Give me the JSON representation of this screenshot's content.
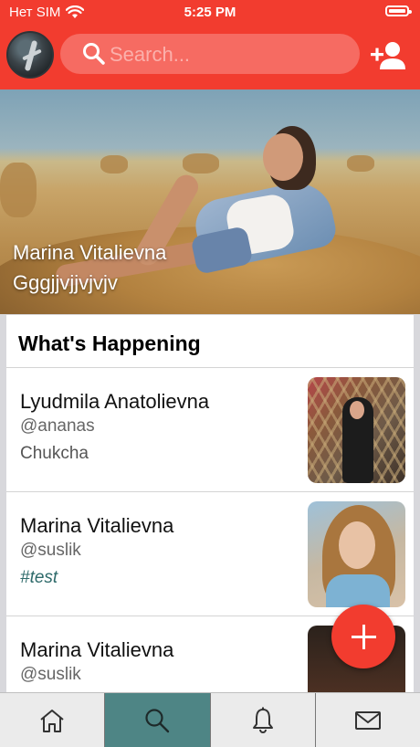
{
  "status_bar": {
    "carrier": "Нет SIM",
    "time": "5:25 PM"
  },
  "header": {
    "search_placeholder": "Search...",
    "brand_color": "#f23c2f",
    "icons": [
      "avatar",
      "search-icon",
      "add-user-icon"
    ]
  },
  "profile": {
    "name": "Marina Vitalievna",
    "bio": "Gggjjvjjvjvjv"
  },
  "feed": {
    "title": "What's Happening",
    "items": [
      {
        "name": "Lyudmila Anatolievna",
        "handle": "@ananas",
        "text": "Chukcha"
      },
      {
        "name": "Marina Vitalievna",
        "handle": "@suslik",
        "text": "#test"
      },
      {
        "name": "Marina Vitalievna",
        "handle": "@suslik",
        "text": ""
      }
    ]
  },
  "tabs": [
    {
      "icon": "home-icon",
      "active": false
    },
    {
      "icon": "search-icon",
      "active": true
    },
    {
      "icon": "bell-icon",
      "active": false
    },
    {
      "icon": "mail-icon",
      "active": false
    }
  ],
  "colors": {
    "active_tab": "#4e8585",
    "hashtag": "#2e6a6a"
  }
}
